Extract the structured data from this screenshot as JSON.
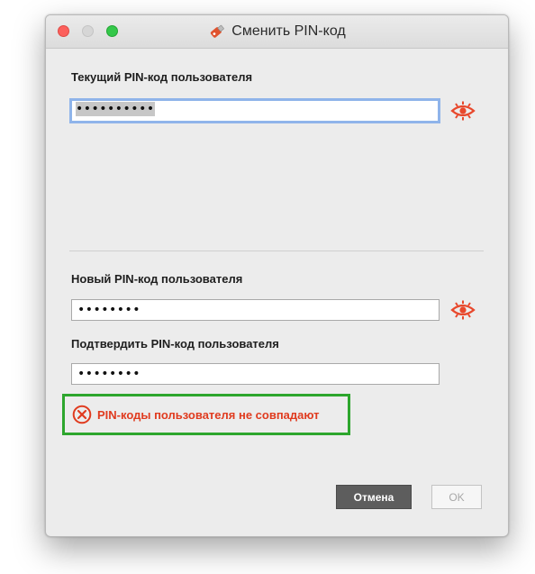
{
  "window": {
    "title": "Сменить PIN-код",
    "title_icon": "usb-token-icon"
  },
  "current_pin": {
    "label": "Текущий PIN-код пользователя",
    "value": "••••••••••",
    "show_icon": "eye-icon"
  },
  "new_pin": {
    "label": "Новый PIN-код пользователя",
    "value": "••••••••",
    "show_icon": "eye-icon"
  },
  "confirm_pin": {
    "label": "Подтвердить PIN-код пользователя",
    "value": "••••••••"
  },
  "error": {
    "icon": "error-circle-x-icon",
    "message": "PIN-коды пользователя не совпадают"
  },
  "buttons": {
    "cancel": "Отмена",
    "ok": "OK"
  },
  "colors": {
    "accent_eye": "#e8482c",
    "error_text": "#e03b1f",
    "highlight_frame": "#2da62d",
    "focus_ring": "#8fb4ea"
  }
}
